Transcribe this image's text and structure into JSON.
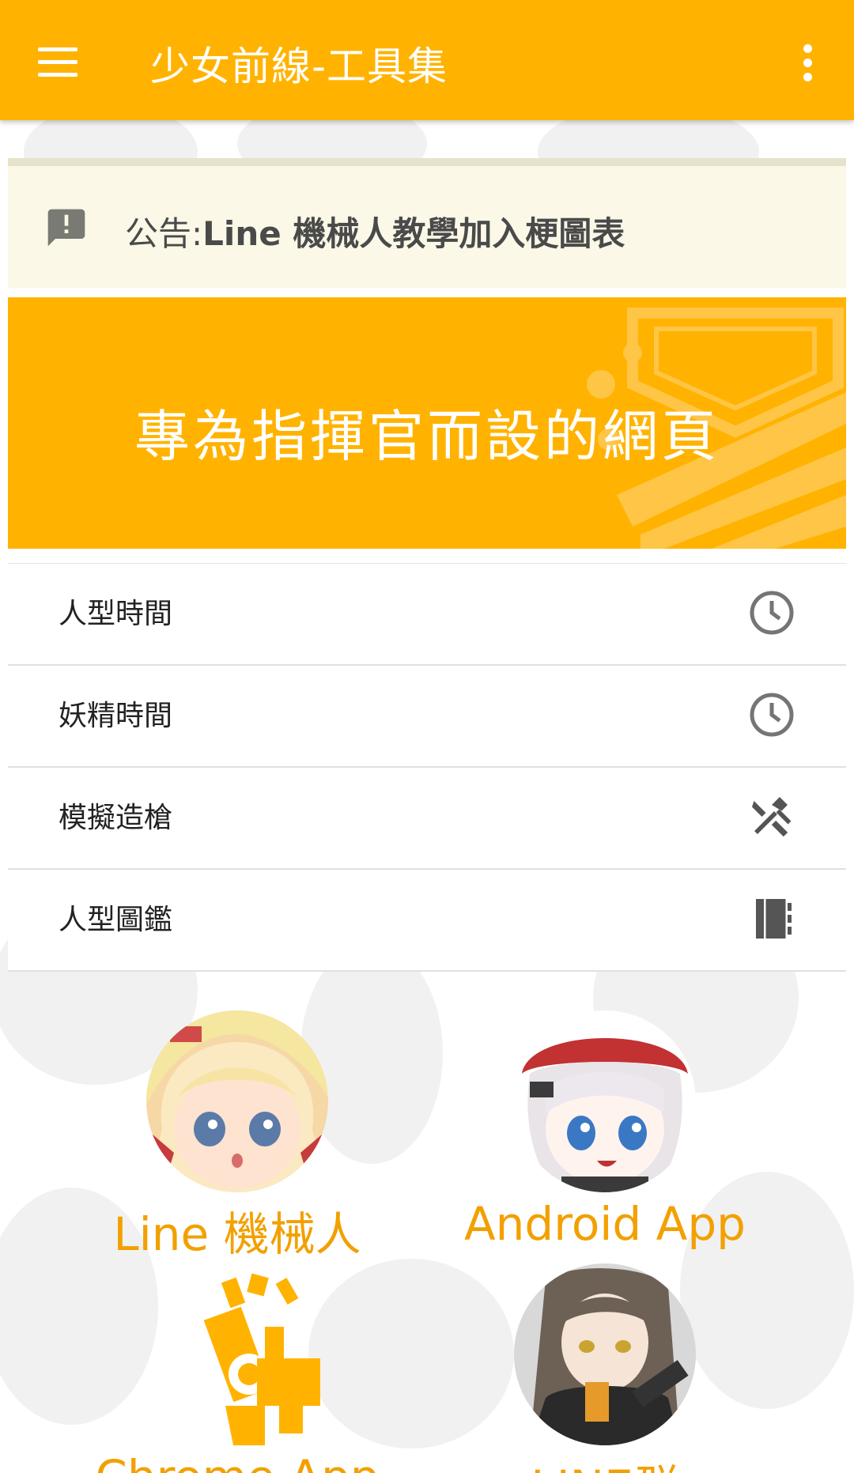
{
  "app_bar": {
    "title": "少女前線-工具集",
    "menu_icon": "hamburger-menu-icon",
    "overflow_icon": "more-vert-icon",
    "color": "#ffb300"
  },
  "notice": {
    "prefix": "公告:",
    "message": "Line 機械人教學加入梗圖表",
    "icon": "announcement-icon"
  },
  "banner": {
    "text": "專為指揮官而設的網頁"
  },
  "menu": [
    {
      "label": "人型時間",
      "icon": "clock-icon"
    },
    {
      "label": "妖精時間",
      "icon": "clock-icon"
    },
    {
      "label": "模擬造槍",
      "icon": "hammer-wrench-icon"
    },
    {
      "label": "人型圖鑑",
      "icon": "book-icon"
    }
  ],
  "shortcuts": [
    {
      "label": "Line 機械人"
    },
    {
      "label": "Android App"
    },
    {
      "label": "Chrome App"
    },
    {
      "label": "LINE群"
    }
  ],
  "colors": {
    "accent": "#ffb300",
    "link_text": "#f2a000",
    "notice_bg": "#fbf8e7"
  }
}
